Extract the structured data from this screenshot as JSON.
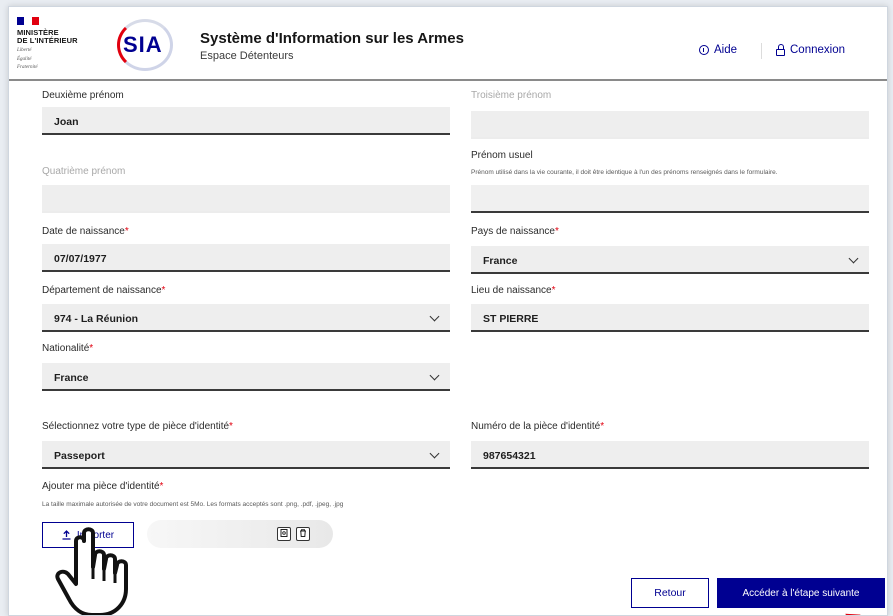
{
  "header": {
    "ministry_line1": "MINISTÈRE",
    "ministry_line2": "DE L'INTÉRIEUR",
    "motto": [
      "Liberté",
      "Égalité",
      "Fraternité"
    ],
    "logo_text": "SIA",
    "app_title": "Système d'Information sur les Armes",
    "app_subtitle": "Espace Détenteurs",
    "help_label": "Aide",
    "login_label": "Connexion"
  },
  "form": {
    "second_first_name": {
      "label": "Deuxième prénom",
      "value": "Joan"
    },
    "third_first_name": {
      "label": "Troisième prénom",
      "value": ""
    },
    "fourth_first_name": {
      "label": "Quatrième prénom",
      "value": ""
    },
    "usual_first_name": {
      "label": "Prénom usuel",
      "hint": "Prénom utilisé dans la vie courante, il doit être identique à l'un des prénoms renseignés dans le formulaire.",
      "value": ""
    },
    "birth_date": {
      "label": "Date de naissance",
      "value": "07/07/1977"
    },
    "birth_country": {
      "label": "Pays de naissance",
      "value": "France"
    },
    "birth_department": {
      "label": "Département de naissance",
      "value": "974 - La Réunion"
    },
    "birth_place": {
      "label": "Lieu de naissance",
      "value": "ST PIERRE"
    },
    "nationality": {
      "label": "Nationalité",
      "value": "France"
    },
    "id_type": {
      "label": "Sélectionnez votre type de pièce d'identité",
      "value": "Passeport"
    },
    "id_number": {
      "label": "Numéro de la pièce d'identité",
      "value": "987654321"
    },
    "id_upload": {
      "label": "Ajouter ma pièce d'identité",
      "hint": "La taille maximale autorisée de votre document est 5Mo. Les formats acceptés sont .png, .pdf, .jpeg, .jpg",
      "button_label": "Importer"
    },
    "required_mark": "*"
  },
  "actions": {
    "back_label": "Retour",
    "next_label": "Accéder à l'étape suivante"
  },
  "colors": {
    "primary": "#000091",
    "required": "#e1000f",
    "field_bg": "#eeeeee"
  },
  "icons": [
    "info-circle-icon",
    "lock-icon",
    "chevron-down-icon",
    "upload-icon",
    "view-file-icon",
    "trash-icon",
    "hand-pointer-icon",
    "red-arrow-icon"
  ]
}
